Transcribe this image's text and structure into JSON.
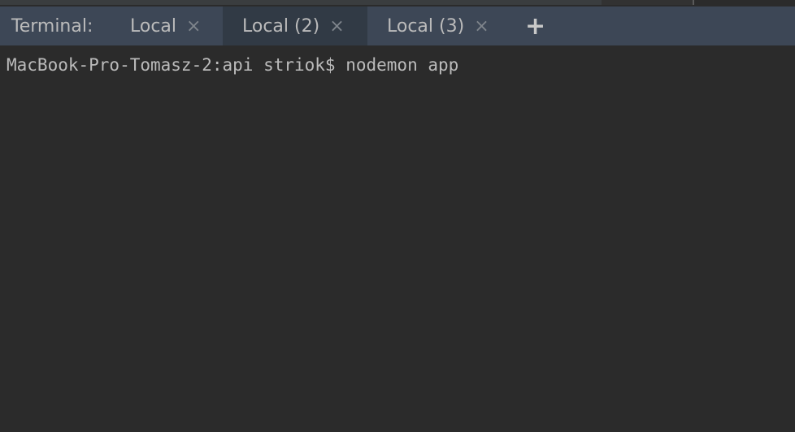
{
  "tool_window": {
    "label": "Terminal:"
  },
  "tabs": [
    {
      "label": "Local",
      "active": false
    },
    {
      "label": "Local (2)",
      "active": true
    },
    {
      "label": "Local (3)",
      "active": false
    }
  ],
  "icons": {
    "close": "×",
    "add": "+"
  },
  "terminal": {
    "line": "MacBook-Pro-Tomasz-2:api striok$ nodemon app"
  },
  "colors": {
    "tabbar": "#3d4756",
    "active_tab": "#313a45",
    "background": "#2b2b2b",
    "text": "#bbbbbb"
  }
}
